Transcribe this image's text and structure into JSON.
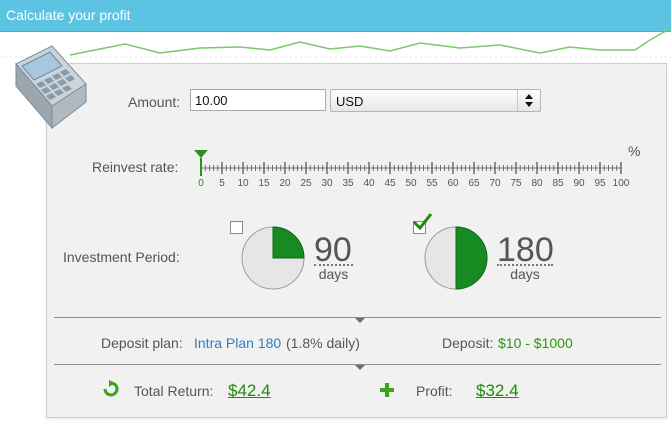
{
  "header": {
    "title": "Calculate your profit"
  },
  "icons": {
    "calculator": "calculator-icon",
    "refresh": "refresh-icon",
    "plus": "plus-icon",
    "check": "checkmark-icon"
  },
  "amount": {
    "label": "Amount:",
    "value": "10.00"
  },
  "currency": {
    "selected": "USD"
  },
  "reinvest": {
    "label": "Reinvest rate:",
    "unit": "%",
    "ticks": [
      "0",
      "5",
      "10",
      "15",
      "20",
      "25",
      "30",
      "35",
      "40",
      "45",
      "50",
      "55",
      "60",
      "65",
      "70",
      "75",
      "80",
      "85",
      "90",
      "95",
      "100"
    ],
    "selected_value": 0
  },
  "period": {
    "label": "Investment Period:",
    "options": [
      {
        "value": "90",
        "unit": "days",
        "checked": false,
        "fraction": 0.25
      },
      {
        "value": "180",
        "unit": "days",
        "checked": true,
        "fraction": 0.5
      }
    ]
  },
  "plan": {
    "label": "Deposit plan:",
    "name": "Intra Plan 180",
    "rate": "(1.8% daily)",
    "deposit_label": "Deposit:",
    "deposit_range": "$10 - $1000"
  },
  "totals": {
    "return_label": "Total Return:",
    "return_value": "$42.4",
    "profit_label": "Profit:",
    "profit_value": "$32.4"
  },
  "colors": {
    "header": "#5cc3e3",
    "accent_green": "#1e8b0c",
    "link_blue": "#2d7fc2"
  }
}
